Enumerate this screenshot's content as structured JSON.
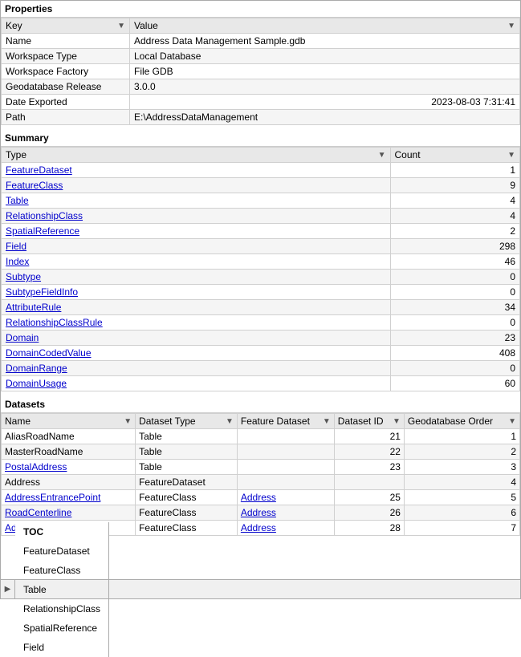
{
  "properties": {
    "header": "Properties",
    "col_key": "Key",
    "col_value": "Value",
    "rows": [
      {
        "key": "Name",
        "value": "Address Data Management Sample.gdb"
      },
      {
        "key": "Workspace Type",
        "value": "Local Database"
      },
      {
        "key": "Workspace Factory",
        "value": "File GDB"
      },
      {
        "key": "Geodatabase Release",
        "value": "3.0.0"
      },
      {
        "key": "Date Exported",
        "value": "2023-08-03 7:31:41"
      },
      {
        "key": "Path",
        "value": "E:\\AddressDataManagement"
      }
    ]
  },
  "summary": {
    "header": "Summary",
    "col_type": "Type",
    "col_count": "Count",
    "rows": [
      {
        "type": "FeatureDataset",
        "count": "1",
        "is_link": true
      },
      {
        "type": "FeatureClass",
        "count": "9",
        "is_link": true
      },
      {
        "type": "Table",
        "count": "4",
        "is_link": true
      },
      {
        "type": "RelationshipClass",
        "count": "4",
        "is_link": true
      },
      {
        "type": "SpatialReference",
        "count": "2",
        "is_link": true
      },
      {
        "type": "Field",
        "count": "298",
        "is_link": true
      },
      {
        "type": "Index",
        "count": "46",
        "is_link": true
      },
      {
        "type": "Subtype",
        "count": "0",
        "is_link": true
      },
      {
        "type": "SubtypeFieldInfo",
        "count": "0",
        "is_link": true
      },
      {
        "type": "AttributeRule",
        "count": "34",
        "is_link": true
      },
      {
        "type": "RelationshipClassRule",
        "count": "0",
        "is_link": true
      },
      {
        "type": "Domain",
        "count": "23",
        "is_link": true
      },
      {
        "type": "DomainCodedValue",
        "count": "408",
        "is_link": true
      },
      {
        "type": "DomainRange",
        "count": "0",
        "is_link": true
      },
      {
        "type": "DomainUsage",
        "count": "60",
        "is_link": true
      }
    ]
  },
  "datasets": {
    "header": "Datasets",
    "columns": [
      "Name",
      "Dataset Type",
      "Feature Dataset",
      "Dataset ID",
      "Geodatabase Order"
    ],
    "rows": [
      {
        "name": "AliasRoadName",
        "type": "Table",
        "feature_dataset": "",
        "id": "21",
        "order": "1",
        "name_link": false,
        "fd_link": false
      },
      {
        "name": "MasterRoadName",
        "type": "Table",
        "feature_dataset": "",
        "id": "22",
        "order": "2",
        "name_link": false,
        "fd_link": false
      },
      {
        "name": "PostalAddress",
        "type": "Table",
        "feature_dataset": "",
        "id": "23",
        "order": "3",
        "name_link": true,
        "fd_link": false
      },
      {
        "name": "Address",
        "type": "FeatureDataset",
        "feature_dataset": "",
        "id": "",
        "order": "4",
        "name_link": false,
        "fd_link": false
      },
      {
        "name": "AddressEntrancePoint",
        "type": "FeatureClass",
        "feature_dataset": "Address",
        "id": "25",
        "order": "5",
        "name_link": true,
        "fd_link": true
      },
      {
        "name": "RoadCenterline",
        "type": "FeatureClass",
        "feature_dataset": "Address",
        "id": "26",
        "order": "6",
        "name_link": true,
        "fd_link": true
      },
      {
        "name": "AddressPoint",
        "type": "FeatureClass",
        "feature_dataset": "Address",
        "id": "28",
        "order": "7",
        "name_link": true,
        "fd_link": true
      }
    ]
  },
  "tabs": {
    "arrow_label": "▶",
    "items": [
      {
        "label": "TOC",
        "active": true
      },
      {
        "label": "FeatureDataset",
        "active": false
      },
      {
        "label": "FeatureClass",
        "active": false
      },
      {
        "label": "Table",
        "active": false
      },
      {
        "label": "RelationshipClass",
        "active": false
      },
      {
        "label": "SpatialReference",
        "active": false
      },
      {
        "label": "Field",
        "active": false
      }
    ]
  }
}
